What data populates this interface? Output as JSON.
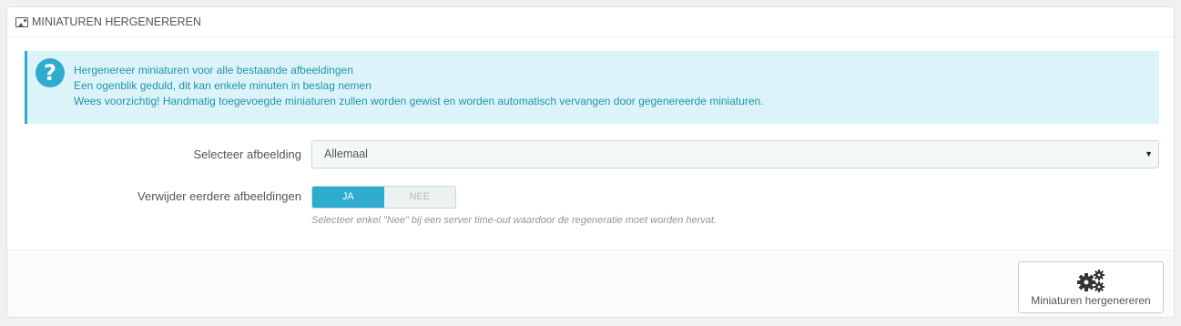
{
  "panel": {
    "title": "MINIATUREN HERGENEREREN",
    "title_icon": "image-icon"
  },
  "alert": {
    "icon": "question-circle-icon",
    "icon_glyph": "?",
    "lines": [
      "Hergenereer miniaturen voor alle bestaande afbeeldingen",
      "Een ogenblik geduld, dit kan enkele minuten in beslag nemen",
      "Wees voorzichtig! Handmatig toegevoegde miniaturen zullen worden gewist en worden automatisch vervangen door gegenereerde miniaturen."
    ]
  },
  "form": {
    "select_image": {
      "label": "Selecteer afbeelding",
      "value": "Allemaal",
      "arrow": "▼"
    },
    "erase_previous": {
      "label": "Verwijder eerdere afbeeldingen",
      "yes": "JA",
      "no": "NEE",
      "selected": "JA",
      "help": "Selecteer enkel \"Nee\" bij een server time-out waardoor de regeneratie moet worden hervat."
    }
  },
  "footer": {
    "regenerate_button": {
      "label": "Miniaturen hergenereren",
      "icon": "gears-icon"
    }
  },
  "colors": {
    "accent": "#2eacce",
    "alert_bg": "#dcf4f9",
    "alert_text": "#1e94ab"
  }
}
